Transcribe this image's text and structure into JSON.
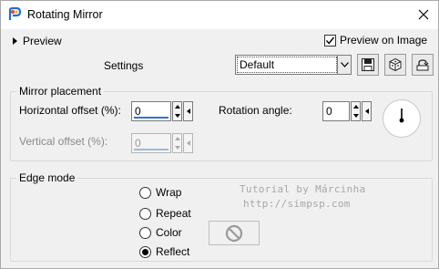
{
  "window": {
    "title": "Rotating Mirror",
    "icon": "paintshop-pro-icon",
    "accent": "#2f74c8"
  },
  "header": {
    "preview_label": "Preview",
    "preview_on_image_label": "Preview on Image",
    "preview_on_image_checked": true,
    "settings_label": "Settings",
    "preset_value": "Default",
    "buttons": [
      "save-preset-icon",
      "randomize-icon",
      "reset-defaults-icon"
    ]
  },
  "mirror_placement": {
    "title": "Mirror placement",
    "horizontal_offset_label": "Horizontal offset (%):",
    "horizontal_offset_value": "0",
    "vertical_offset_label": "Vertical offset (%):",
    "vertical_offset_value": "0",
    "rotation_angle_label": "Rotation angle:",
    "rotation_angle_value": "0"
  },
  "edge_mode": {
    "title": "Edge mode",
    "options": [
      {
        "label": "Wrap",
        "selected": false
      },
      {
        "label": "Repeat",
        "selected": false
      },
      {
        "label": "Color",
        "selected": false
      },
      {
        "label": "Reflect",
        "selected": true
      }
    ]
  },
  "watermark": {
    "line1": "Tutorial by Márcinha",
    "line2": "http://simpsp.com"
  }
}
